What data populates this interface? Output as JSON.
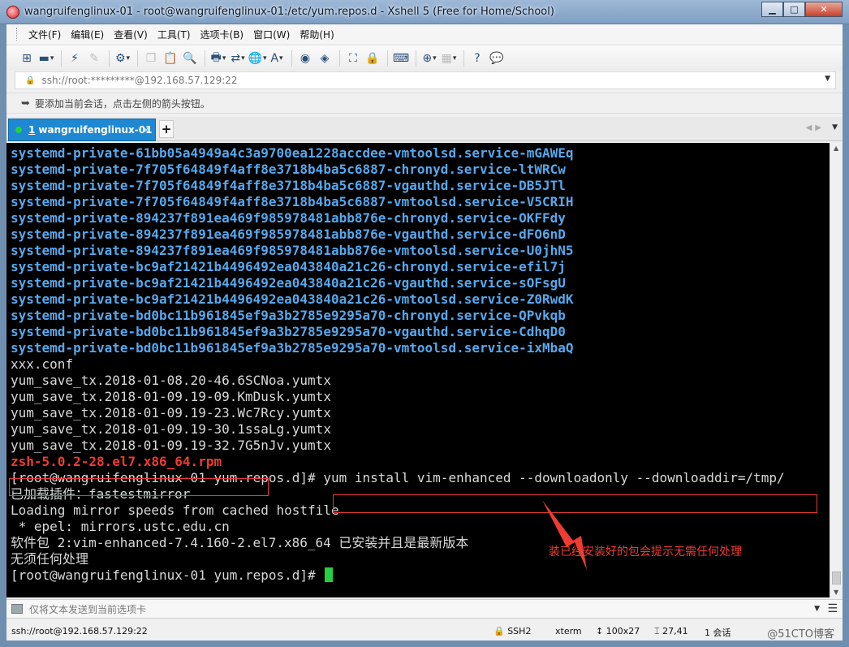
{
  "window": {
    "title": "wangruifenglinux-01 - root@wangruifenglinux-01:/etc/yum.repos.d - Xshell 5 (Free for Home/School)",
    "buttons": {
      "minimize": "▁",
      "maximize": "□",
      "close": "✕"
    }
  },
  "menu": [
    "文件(F)",
    "编辑(E)",
    "查看(V)",
    "工具(T)",
    "选项卡(B)",
    "窗口(W)",
    "帮助(H)"
  ],
  "address": {
    "lock_icon": "🔒",
    "value": "ssh://root:*********@192.168.57.129:22"
  },
  "hint": {
    "text": "要添加当前会话，点击左侧的箭头按钮。"
  },
  "tab": {
    "number": "1",
    "label": "wangruifenglinux-01",
    "close": "×",
    "add": "+"
  },
  "terminal_lines": [
    {
      "text": "systemd-private-61bb05a4949a4c3a9700ea1228accdee-vmtoolsd.service-mGAWEq",
      "style": "blue"
    },
    {
      "text": "systemd-private-7f705f64849f4aff8e3718b4ba5c6887-chronyd.service-ltWRCw",
      "style": "blue"
    },
    {
      "text": "systemd-private-7f705f64849f4aff8e3718b4ba5c6887-vgauthd.service-DB5JTl",
      "style": "blue"
    },
    {
      "text": "systemd-private-7f705f64849f4aff8e3718b4ba5c6887-vmtoolsd.service-V5CRIH",
      "style": "blue"
    },
    {
      "text": "systemd-private-894237f891ea469f985978481abb876e-chronyd.service-OKFFdy",
      "style": "blue"
    },
    {
      "text": "systemd-private-894237f891ea469f985978481abb876e-vgauthd.service-dFO6nD",
      "style": "blue"
    },
    {
      "text": "systemd-private-894237f891ea469f985978481abb876e-vmtoolsd.service-U0jhN5",
      "style": "blue"
    },
    {
      "text": "systemd-private-bc9af21421b4496492ea043840a21c26-chronyd.service-efil7j",
      "style": "blue"
    },
    {
      "text": "systemd-private-bc9af21421b4496492ea043840a21c26-vgauthd.service-sOFsgU",
      "style": "blue"
    },
    {
      "text": "systemd-private-bc9af21421b4496492ea043840a21c26-vmtoolsd.service-Z0RwdK",
      "style": "blue"
    },
    {
      "text": "systemd-private-bd0bc11b961845ef9a3b2785e9295a70-chronyd.service-QPvkqb",
      "style": "blue"
    },
    {
      "text": "systemd-private-bd0bc11b961845ef9a3b2785e9295a70-vgauthd.service-CdhqD0",
      "style": "blue"
    },
    {
      "text": "systemd-private-bd0bc11b961845ef9a3b2785e9295a70-vmtoolsd.service-ixMbaQ",
      "style": "blue"
    },
    {
      "text": "xxx.conf",
      "style": "plain"
    },
    {
      "text": "yum_save_tx.2018-01-08.20-46.6SCNoa.yumtx",
      "style": "plain"
    },
    {
      "text": "yum_save_tx.2018-01-09.19-09.KmDusk.yumtx",
      "style": "plain"
    },
    {
      "text": "yum_save_tx.2018-01-09.19-23.Wc7Rcy.yumtx",
      "style": "plain"
    },
    {
      "text": "yum_save_tx.2018-01-09.19-30.1ssaLg.yumtx",
      "style": "plain"
    },
    {
      "text": "yum_save_tx.2018-01-09.19-32.7G5nJv.yumtx",
      "style": "plain"
    },
    {
      "text": "zsh-5.0.2-28.el7.x86_64.rpm",
      "style": "red"
    },
    {
      "text": "[root@wangruifenglinux-01 yum.repos.d]# yum install vim-enhanced --downloadonly --downloaddir=/tmp/",
      "style": "plain"
    },
    {
      "text": "已加载插件：fastestmirror",
      "style": "plain"
    },
    {
      "text": "Loading mirror speeds from cached hostfile",
      "style": "plain"
    },
    {
      "text": " * epel: mirrors.ustc.edu.cn",
      "style": "plain"
    },
    {
      "text": "软件包 2:vim-enhanced-7.4.160-2.el7.x86_64 已安装并且是最新版本",
      "style": "plain"
    },
    {
      "text": "无须任何处理",
      "style": "plain"
    },
    {
      "text": "[root@wangruifenglinux-01 yum.repos.d]# ",
      "style": "plain",
      "cursor": true
    }
  ],
  "annotation": {
    "text": "装已经安装好的包会提示无需任何处理"
  },
  "sendbar": {
    "placeholder": "仅将文本发送到当前选项卡"
  },
  "status": {
    "connection": "ssh://root@192.168.57.129:22",
    "protocol": "SSH2",
    "terminal": "xterm",
    "size": "100x27",
    "position": "27,41",
    "sessions": "1 会话",
    "watermark": "@51CTO博客"
  },
  "colors": {
    "terminal_bg": "#000000",
    "dir_blue": "#57a8ec",
    "highlight_red": "#ee3c32",
    "cursor_green": "#22d13d",
    "tab_blue": "#1e88d3"
  }
}
